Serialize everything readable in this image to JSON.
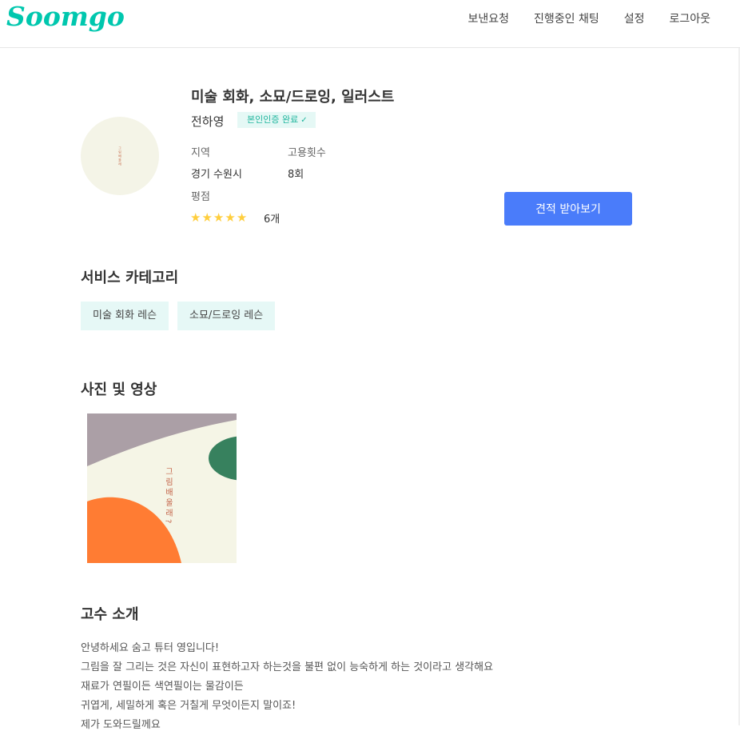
{
  "header": {
    "logo": "Soomgo",
    "nav": [
      "보낸요청",
      "진행중인 채팅",
      "설정",
      "로그아웃"
    ]
  },
  "profile": {
    "avatar_text": "그림배울래",
    "service_title": "미술 회화, 소묘/드로잉, 일러스트",
    "name": "전하영",
    "verified_label": "본인인증 완료",
    "region_label": "지역",
    "region_value": "경기 수원시",
    "hires_label": "고용횟수",
    "hires_value": "8회",
    "rating_label": "평점",
    "rating": 5,
    "review_count": "6개",
    "quote_button": "견적 받아보기"
  },
  "categories": {
    "heading": "서비스 카테고리",
    "items": [
      "미술 회화 레슨",
      "소묘/드로잉 레슨"
    ]
  },
  "media": {
    "heading": "사진 및 영상",
    "photo_text": "그림배울래?"
  },
  "intro": {
    "heading": "고수 소개",
    "lines": [
      "안녕하세요 숨고 튜터 영입니다!",
      "그림을 잘 그리는 것은 자신이 표현하고자 하는것을 불편 없이 능숙하게 하는 것이라고 생각해요",
      "재료가 연필이든 색연필이는 물감이든",
      "귀엽게, 세밀하게 혹은 거칠게 무엇이든지 말이죠!",
      "제가 도와드릴께요"
    ]
  },
  "colors": {
    "brand": "#00c7ae",
    "primary_button": "#4a7cfa",
    "star": "#ffce3d",
    "tag_bg": "#e6f8f6"
  }
}
